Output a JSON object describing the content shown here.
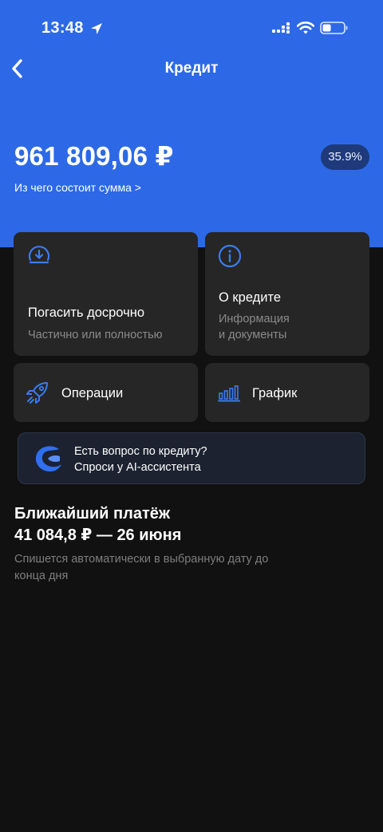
{
  "status_bar": {
    "time": "13:48",
    "icons": [
      "location-arrow-icon",
      "cellular-signal-icon",
      "wifi-icon",
      "battery-icon"
    ]
  },
  "header": {
    "title": "Кредит",
    "back_icon": "chevron-left-icon"
  },
  "summary": {
    "amount": "961 809,06 ₽",
    "rate": "35.9%",
    "breakdown_link": "Из чего состоит сумма >"
  },
  "actions": {
    "repay": {
      "title": "Погасить досрочно",
      "subtitle": "Частично или полностью",
      "icon": "download-circle-icon"
    },
    "about": {
      "title": "О кредите",
      "subtitle_line1": "Информация",
      "subtitle_line2": "и документы",
      "icon": "info-circle-icon"
    },
    "operations": {
      "title": "Операции",
      "icon": "rocket-icon"
    },
    "schedule": {
      "title": "График",
      "icon": "bar-chart-icon"
    }
  },
  "assistant": {
    "line1": "Есть вопрос по кредиту?",
    "line2": "Спроси у AI-ассистента",
    "icon": "assistant-logo-icon"
  },
  "next_payment": {
    "title": "Ближайший платёж",
    "amount": "41 084,8 ₽ — 26 июня",
    "note": "Спишется автоматически в выбранную дату до конца дня"
  },
  "colors": {
    "accent": "#2d69e6",
    "background": "#111111",
    "card": "#262626",
    "icon_blue": "#3b7bf0",
    "badge_bg": "#1e3a7a"
  }
}
